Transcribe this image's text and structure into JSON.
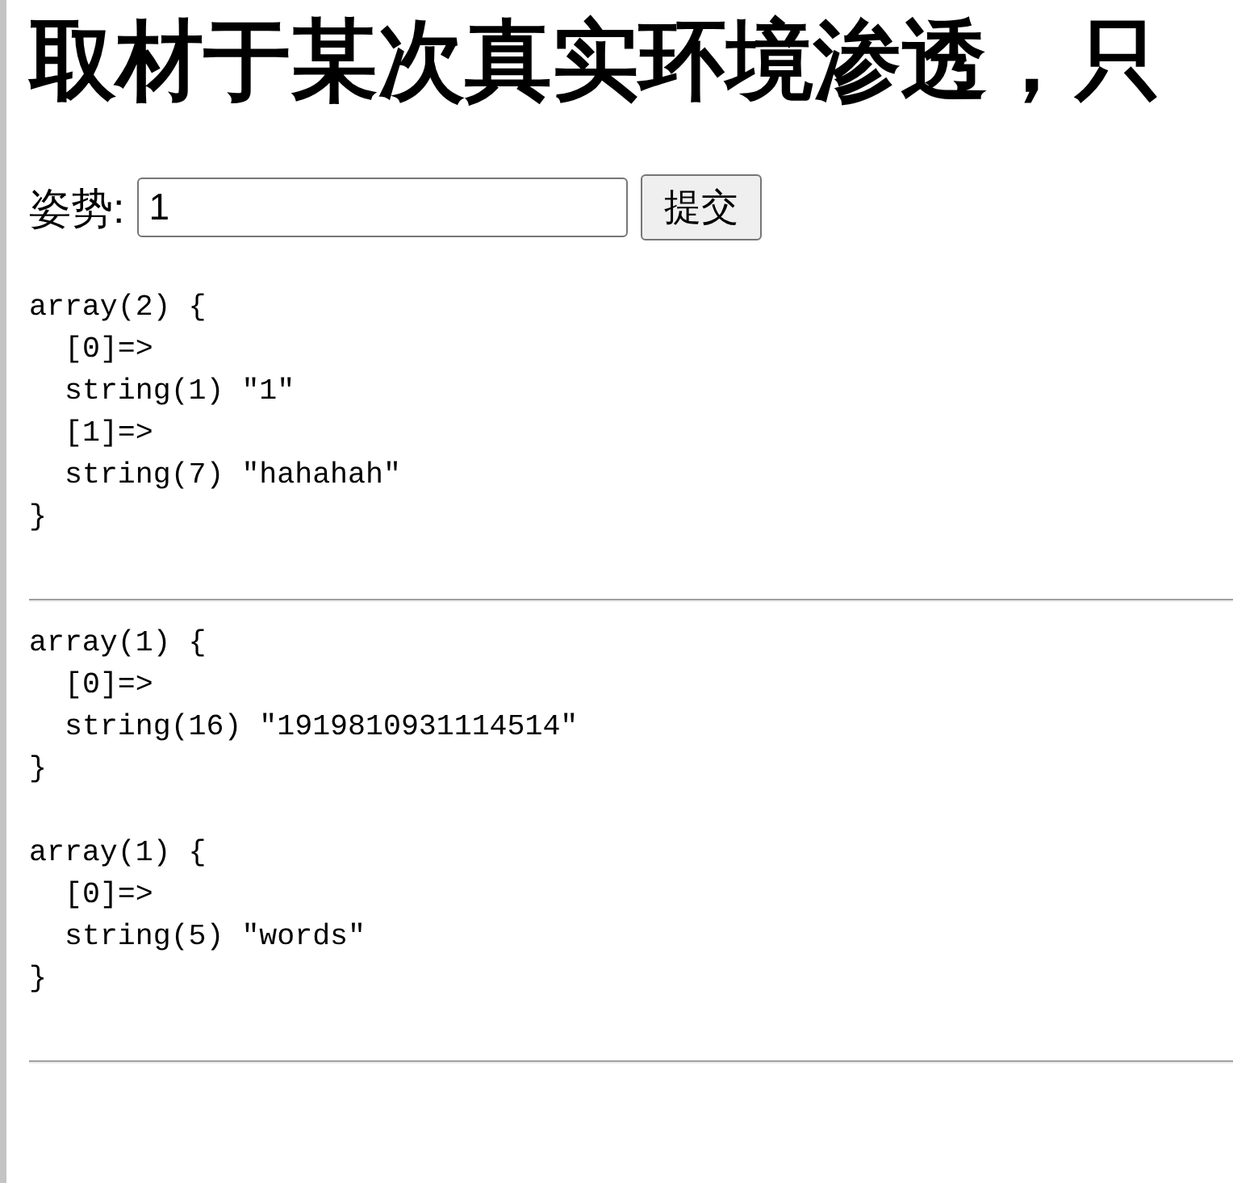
{
  "heading": "取材于某次真实环境渗透，只",
  "form": {
    "label": "姿势:",
    "input": {
      "value": "1"
    },
    "button": "提交"
  },
  "output": [
    {
      "kind": "dump",
      "header": "array(2) {",
      "entries": [
        {
          "key": "[0]=>",
          "value": "string(1) \"1\""
        },
        {
          "key": "[1]=>",
          "value": "string(7) \"hahahah\""
        }
      ],
      "footer": "}"
    },
    {
      "kind": "rule"
    },
    {
      "kind": "dump",
      "header": "array(1) {",
      "entries": [
        {
          "key": "[0]=>",
          "value": "string(16) \"1919810931114514\""
        }
      ],
      "footer": "}"
    },
    {
      "kind": "dump",
      "header": "array(1) {",
      "entries": [
        {
          "key": "[0]=>",
          "value": "string(5) \"words\""
        }
      ],
      "footer": "}"
    },
    {
      "kind": "rule"
    }
  ]
}
